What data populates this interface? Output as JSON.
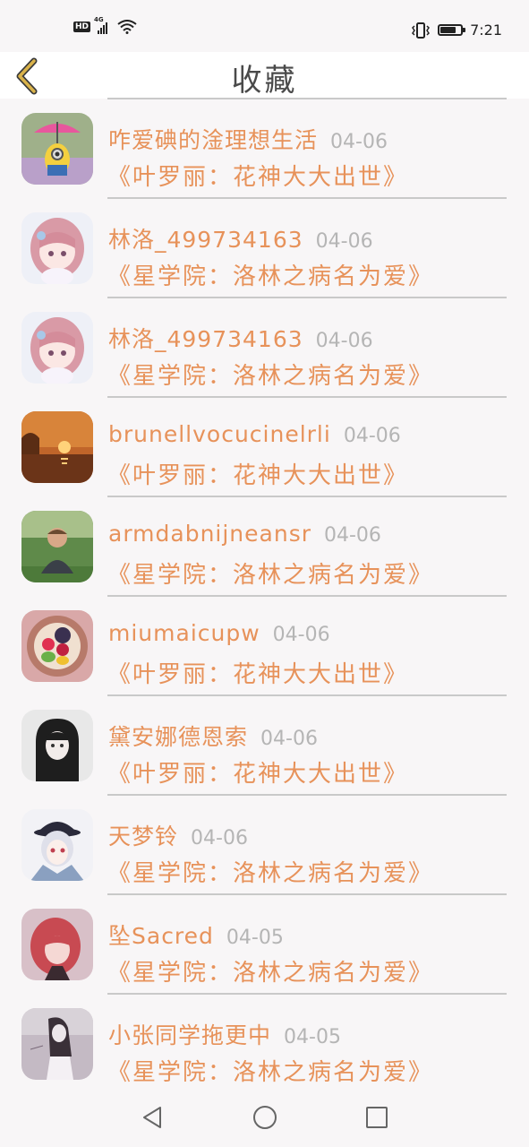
{
  "status_bar": {
    "hd": "HD",
    "network": "4G",
    "time": "7:21",
    "battery_level": 0.75
  },
  "header": {
    "title": "收藏",
    "back_icon": "chevron-left-icon",
    "accent": "#c8a03c"
  },
  "colors": {
    "primary_text": "#e7925a",
    "date_text": "#b5b5b5",
    "divider": "#c9c9c9"
  },
  "favorites": [
    {
      "name": "咋爱碘的淦理想生活",
      "date": "04-06",
      "book": "《叶罗丽：花神大大出世》",
      "avatar": "minion-umbrella"
    },
    {
      "name": "林洛_499734163",
      "date": "04-06",
      "book": "《星学院：洛林之病名为爱》",
      "avatar": "anime-girl-pink"
    },
    {
      "name": "林洛_499734163",
      "date": "04-06",
      "book": "《星学院：洛林之病名为爱》",
      "avatar": "anime-girl-pink"
    },
    {
      "name": "brunellvocucinelrli",
      "date": "04-06",
      "book": "《叶罗丽：花神大大出世》",
      "avatar": "sunset"
    },
    {
      "name": "armdabnijneansr",
      "date": "04-06",
      "book": "《星学院：洛林之病名为爱》",
      "avatar": "man-park"
    },
    {
      "name": "miumaicupw",
      "date": "04-06",
      "book": "《叶罗丽：花神大大出世》",
      "avatar": "fruit-bowl"
    },
    {
      "name": "黛安娜德恩索",
      "date": "04-06",
      "book": "《叶罗丽：花神大大出世》",
      "avatar": "dark-hair-girl"
    },
    {
      "name": "天梦铃",
      "date": "04-06",
      "book": "《星学院：洛林之病名为爱》",
      "avatar": "anime-boy-hat"
    },
    {
      "name": "坠Sacred",
      "date": "04-05",
      "book": "《星学院：洛林之病名为爱》",
      "avatar": "red-hair-girl"
    },
    {
      "name": "小张同学拖更中",
      "date": "04-05",
      "book": "《星学院：洛林之病名为爱》",
      "avatar": "sketch-girl"
    }
  ],
  "nav_bar": {
    "back": "nav-back-icon",
    "home": "nav-home-icon",
    "recent": "nav-recent-icon"
  }
}
